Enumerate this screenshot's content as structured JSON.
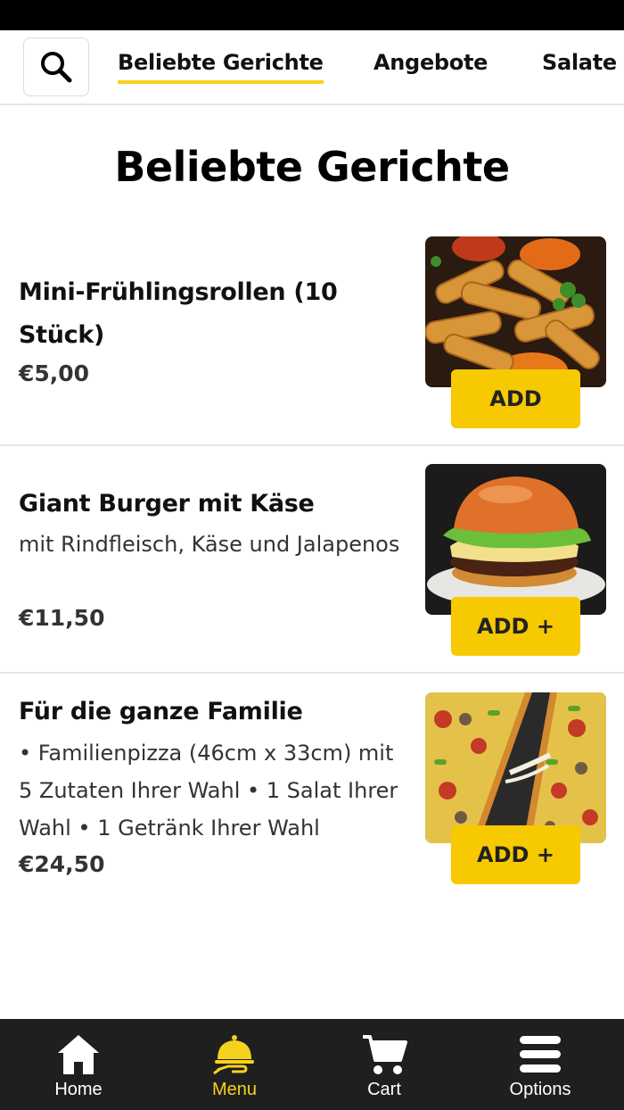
{
  "nav": {
    "tabs": [
      {
        "label": "Beliebte Gerichte",
        "active": true
      },
      {
        "label": "Angebote",
        "active": false
      },
      {
        "label": "Salate",
        "active": false
      }
    ]
  },
  "section": {
    "title": "Beliebte Gerichte"
  },
  "items": [
    {
      "name": "Mini-Frühlingsrollen (10 Stück)",
      "description": "",
      "price": "€5,00",
      "button": "ADD",
      "image": "spring-rolls-image"
    },
    {
      "name": "Giant Burger mit Käse",
      "description": "mit Rindfleisch, Käse und Jalapenos",
      "price": "€11,50",
      "button": "ADD +",
      "image": "burger-image"
    },
    {
      "name": "Für die ganze Familie",
      "description": "• Familienpizza (46cm x 33cm) mit 5 Zutaten Ihrer Wahl • 1 Salat Ihrer Wahl • 1 Getränk Ihrer Wahl",
      "price": "€24,50",
      "button": "ADD +",
      "image": "pizza-image"
    }
  ],
  "bottom_nav": {
    "items": [
      {
        "label": "Home",
        "icon": "home-icon",
        "active": false
      },
      {
        "label": "Menu",
        "icon": "cloche-icon",
        "active": true
      },
      {
        "label": "Cart",
        "icon": "cart-icon",
        "active": false
      },
      {
        "label": "Options",
        "icon": "menu-icon",
        "active": false
      }
    ]
  },
  "colors": {
    "accent": "#f7d21c",
    "button": "#f7c900",
    "nav_bg": "#1f1f1f"
  }
}
